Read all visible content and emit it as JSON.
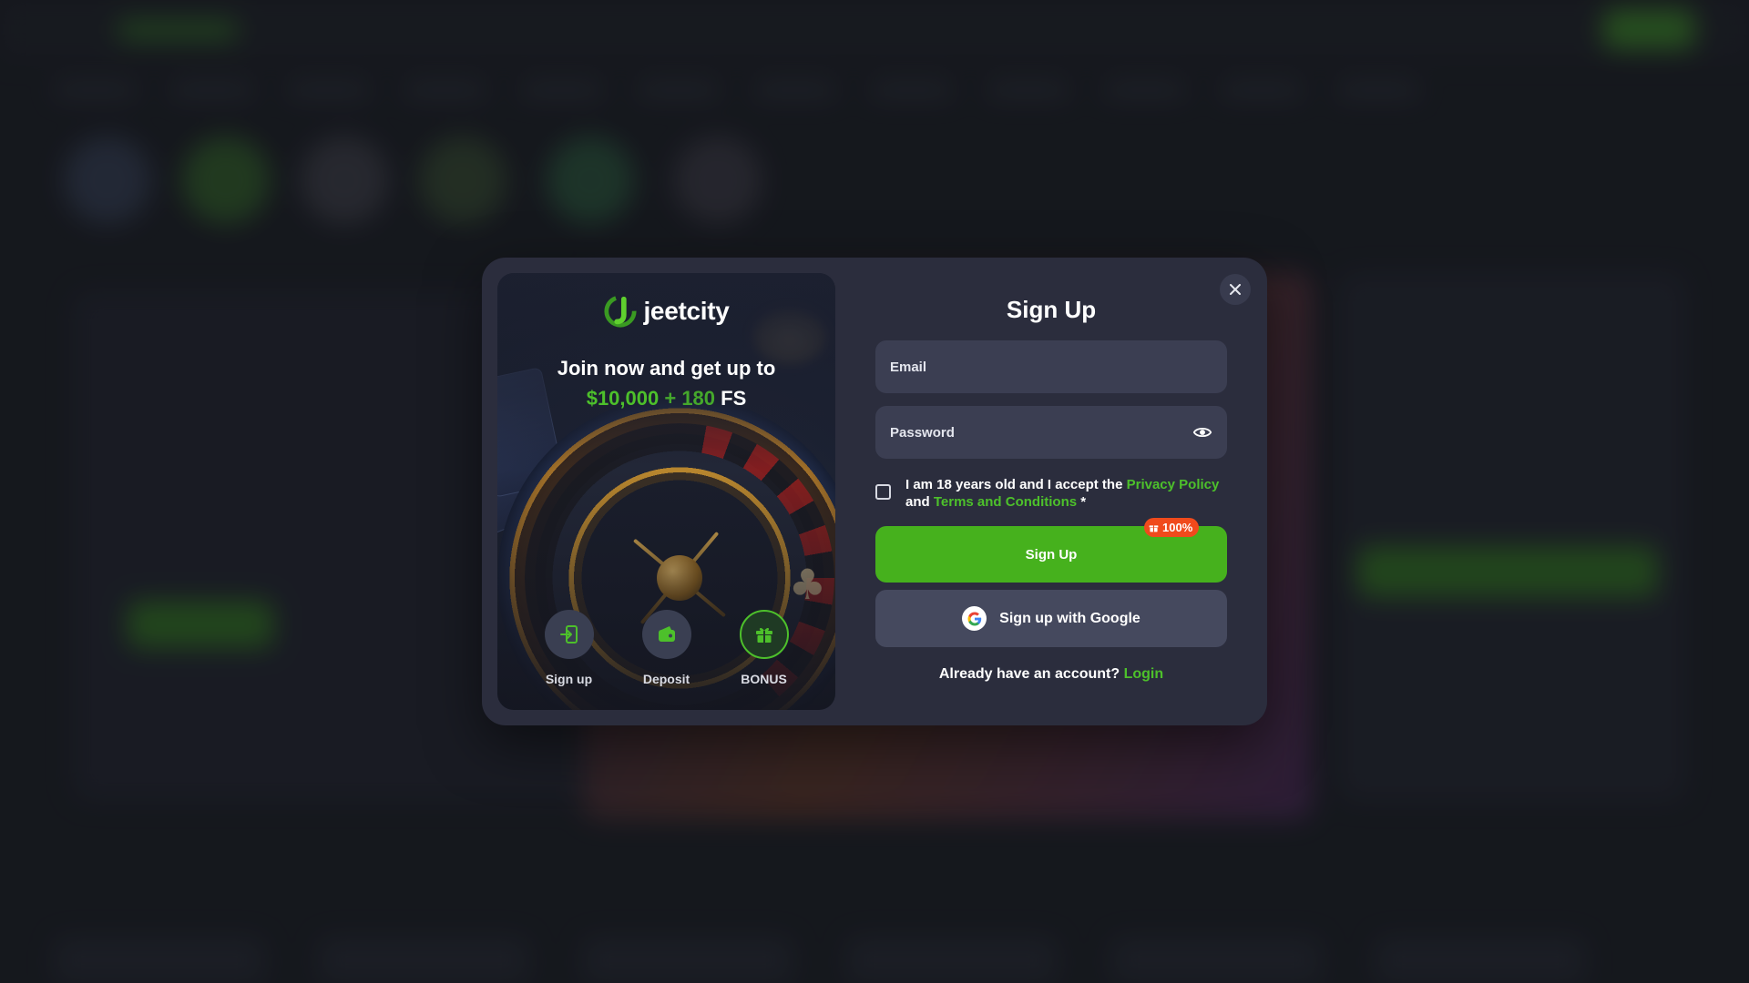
{
  "promo": {
    "brand_name": "jeetcity",
    "headline": "Join now and get up to",
    "amount": "$10,000",
    "plus": "+ 180",
    "fs": "FS",
    "steps": [
      {
        "label": "Sign up",
        "icon": "sign-in-icon"
      },
      {
        "label": "Deposit",
        "icon": "wallet-icon"
      },
      {
        "label": "BONUS",
        "icon": "gift-icon"
      }
    ]
  },
  "form": {
    "title": "Sign Up",
    "email_placeholder": "Email",
    "password_placeholder": "Password",
    "terms_prefix": "I am 18 years old and I accept the",
    "privacy_link": "Privacy Policy",
    "terms_and": "and",
    "terms_link": "Terms and Conditions",
    "required_mark": "*",
    "submit_label": "Sign Up",
    "bonus_badge": "100%",
    "google_label": "Sign up with Google",
    "login_prompt": "Already have an account?",
    "login_link": "Login"
  },
  "colors": {
    "accent_green": "#46b11d",
    "badge_orange": "#f04a1c",
    "modal_bg": "#2b2d3d",
    "field_bg": "#3b3e52"
  }
}
